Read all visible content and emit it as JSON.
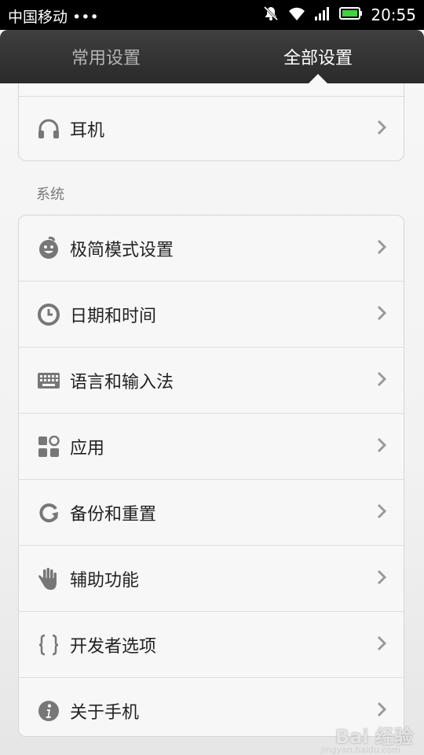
{
  "status_bar": {
    "carrier": "中国移动 •••",
    "time": "20:55",
    "icons": [
      "mute-icon",
      "wifi-icon",
      "signal-icon",
      "battery-icon"
    ]
  },
  "tabs": [
    {
      "label": "常用设置",
      "active": false
    },
    {
      "label": "全部设置",
      "active": true
    }
  ],
  "top_card": {
    "items": [
      {
        "label": "耳机",
        "icon": "headphones-icon"
      }
    ]
  },
  "system_section": {
    "label": "系统",
    "items": [
      {
        "label": "极简模式设置",
        "icon": "smiley-icon"
      },
      {
        "label": "日期和时间",
        "icon": "clock-icon"
      },
      {
        "label": "语言和输入法",
        "icon": "keyboard-icon"
      },
      {
        "label": "应用",
        "icon": "apps-icon"
      },
      {
        "label": "备份和重置",
        "icon": "refresh-icon"
      },
      {
        "label": "辅助功能",
        "icon": "hand-icon"
      },
      {
        "label": "开发者选项",
        "icon": "braces-icon"
      },
      {
        "label": "关于手机",
        "icon": "info-icon"
      }
    ]
  },
  "watermark": {
    "text": "Bai 经验",
    "sub": "jingyan.baidu.com"
  },
  "colors": {
    "tab_bar": "#333333",
    "icon_gray": "#777777",
    "text": "#222222",
    "chevron": "#9a9a9a"
  }
}
